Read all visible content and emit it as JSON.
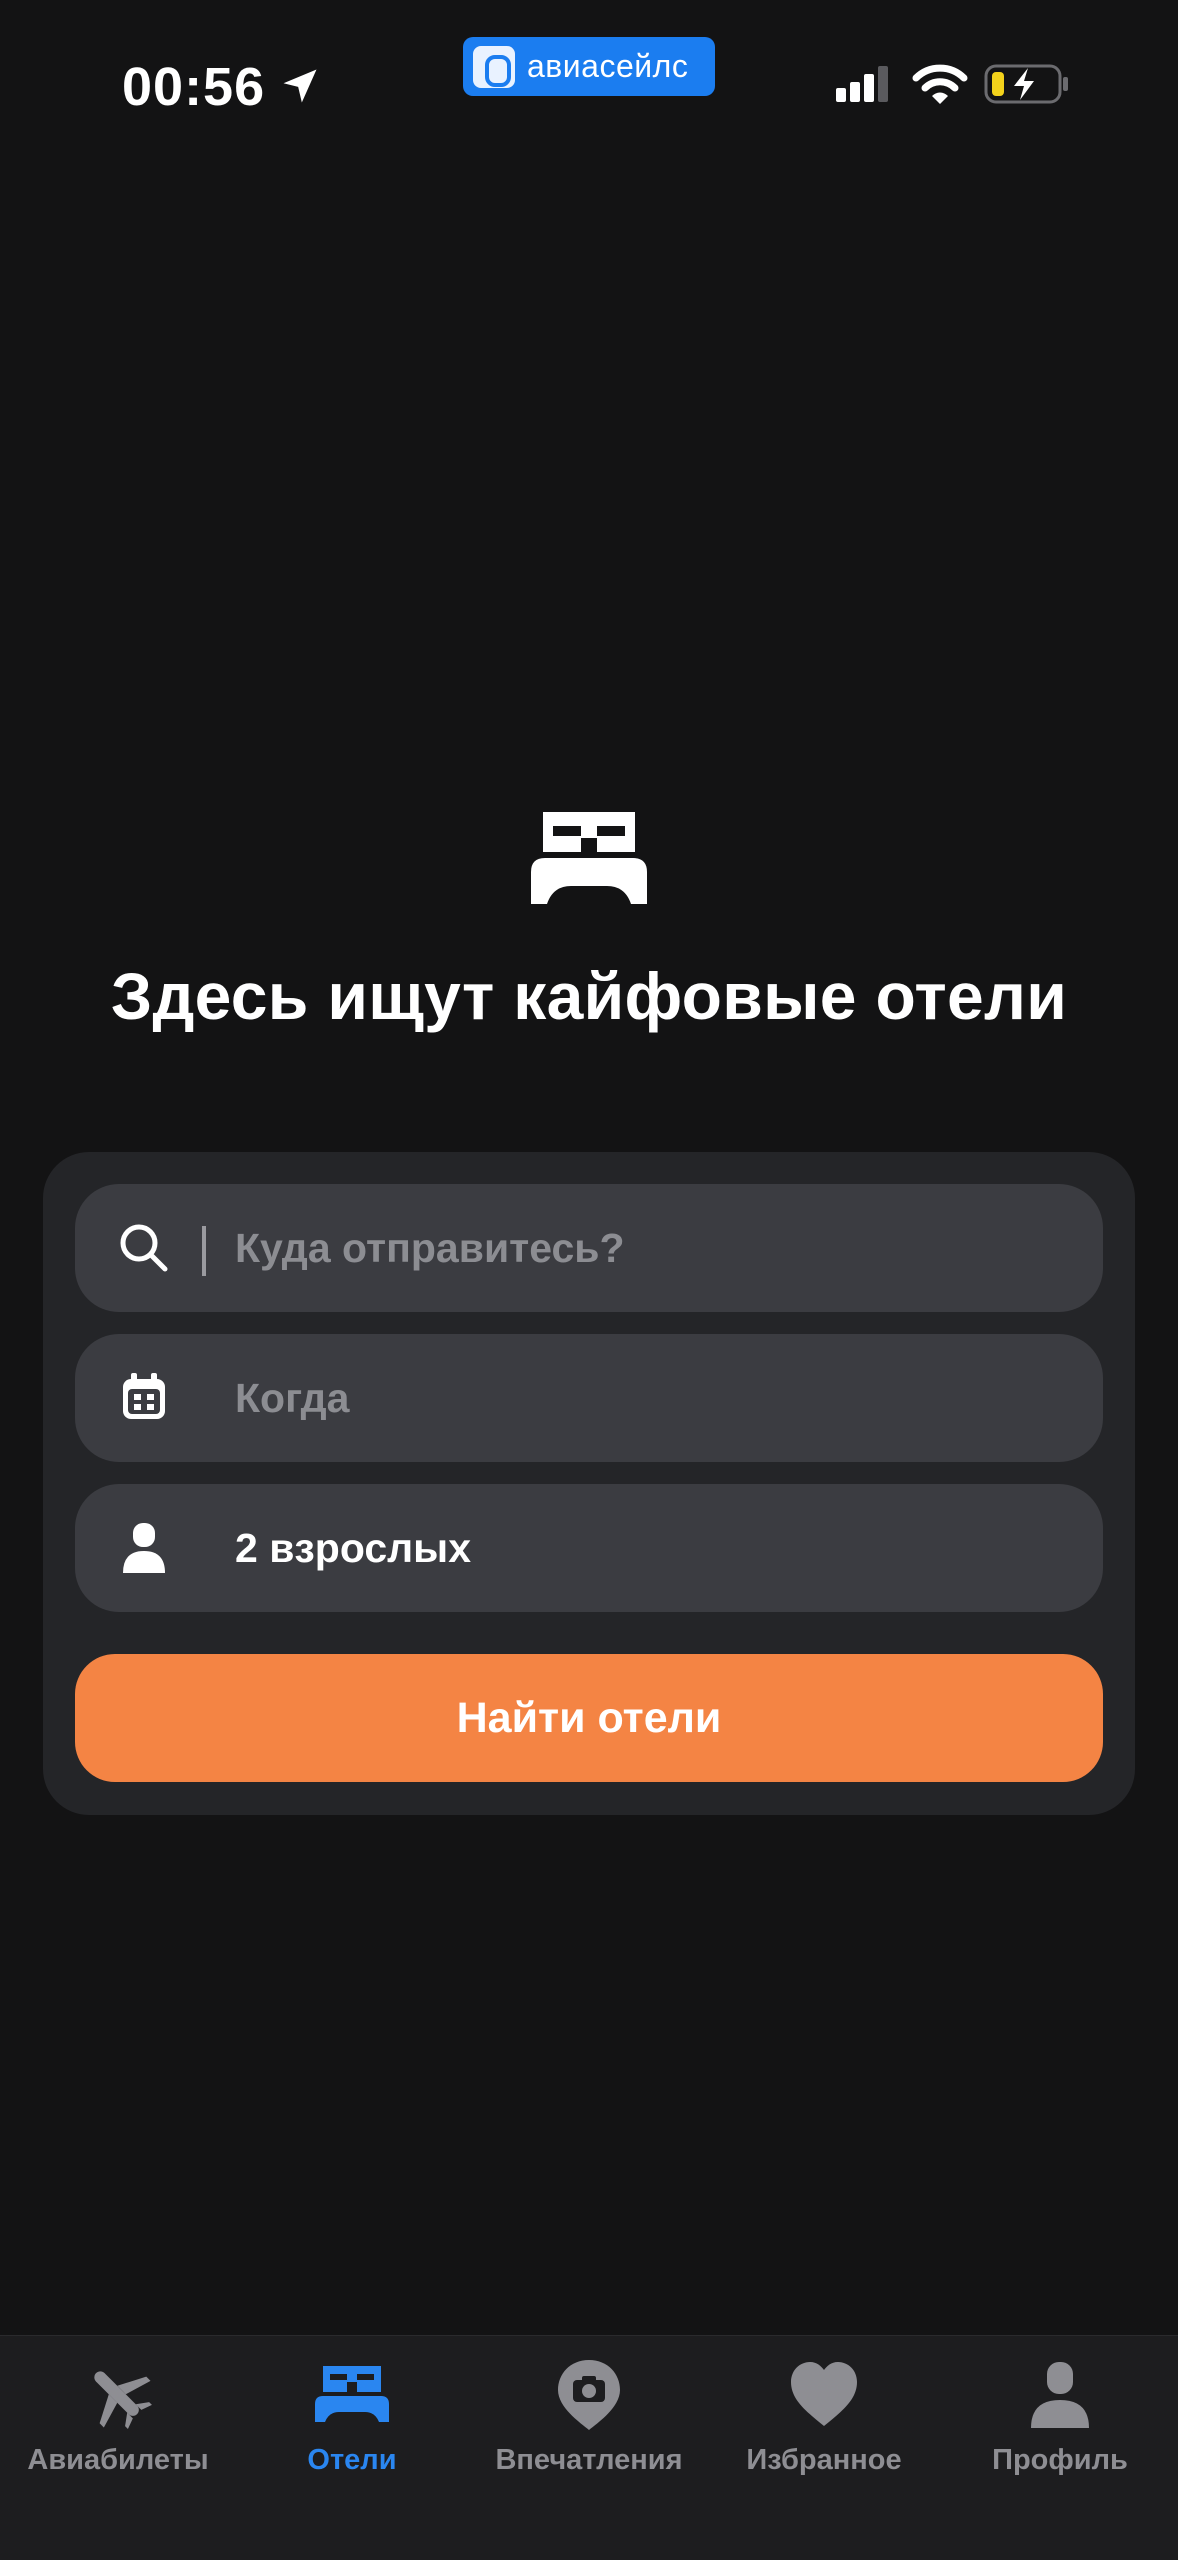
{
  "status_bar": {
    "time": "00:56",
    "app_badge": "авиасейлс",
    "icons": [
      "location-arrow-icon",
      "cellular-signal-icon",
      "wifi-icon",
      "battery-charging-icon"
    ]
  },
  "hero": {
    "icon": "bed-icon",
    "title": "Здесь ищут кайфовые отели"
  },
  "search_form": {
    "destination": {
      "placeholder": "Куда отправитесь?",
      "value": "",
      "icon": "search-icon"
    },
    "dates": {
      "placeholder": "Когда",
      "value": "",
      "icon": "calendar-icon"
    },
    "guests": {
      "value": "2 взрослых",
      "icon": "person-icon"
    },
    "submit_label": "Найти отели"
  },
  "tab_bar": {
    "items": [
      {
        "label": "Авиабилеты",
        "icon": "airplane-icon",
        "active": false
      },
      {
        "label": "Отели",
        "icon": "bed-icon",
        "active": true
      },
      {
        "label": "Впечатления",
        "icon": "map-pin-camera-icon",
        "active": false
      },
      {
        "label": "Избранное",
        "icon": "heart-icon",
        "active": false
      },
      {
        "label": "Профиль",
        "icon": "person-icon",
        "active": false
      }
    ]
  },
  "colors": {
    "background": "#131314",
    "card": "#242528",
    "field": "#3b3c41",
    "accent_orange": "#f48444",
    "active_tab": "#2a86f0",
    "inactive_tab": "#8e8e93",
    "badge_blue": "#1b7df0"
  }
}
